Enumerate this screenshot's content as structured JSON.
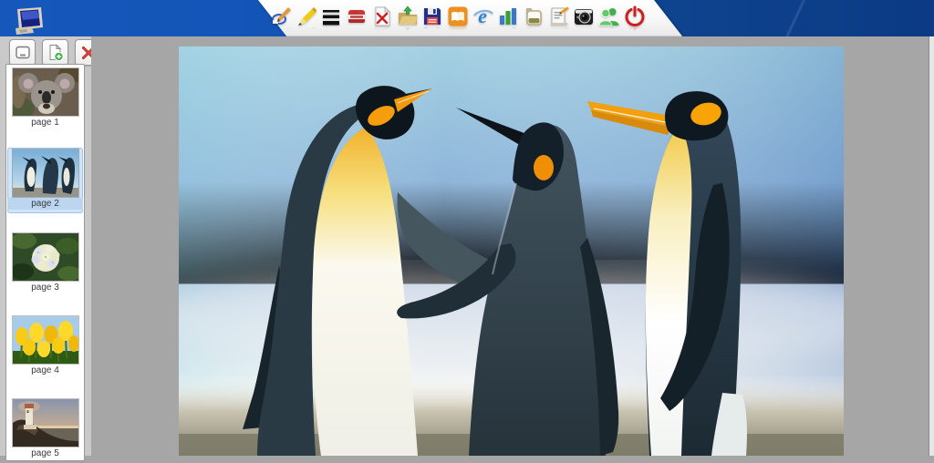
{
  "titlebar": {
    "desktop_icon": "my-computer"
  },
  "toolbar": {
    "items": [
      {
        "name": "pen"
      },
      {
        "name": "highlighter"
      },
      {
        "name": "line-width"
      },
      {
        "name": "eraser"
      },
      {
        "name": "clear-page"
      },
      {
        "name": "open-folder"
      },
      {
        "name": "save"
      },
      {
        "name": "book"
      },
      {
        "name": "browser"
      },
      {
        "name": "chart"
      },
      {
        "name": "cup"
      },
      {
        "name": "notes"
      },
      {
        "name": "camera"
      },
      {
        "name": "users"
      },
      {
        "name": "power"
      }
    ]
  },
  "sidebar": {
    "buttons": [
      {
        "name": "board"
      },
      {
        "name": "add-page"
      },
      {
        "name": "delete-page"
      }
    ],
    "pages": [
      {
        "label": "page 1",
        "subject": "koala",
        "selected": false
      },
      {
        "label": "page 2",
        "subject": "penguins",
        "selected": true
      },
      {
        "label": "page 3",
        "subject": "flower",
        "selected": false
      },
      {
        "label": "page 4",
        "subject": "tulips",
        "selected": false
      },
      {
        "label": "page 5",
        "subject": "lighthouse",
        "selected": false
      }
    ],
    "selected_page": "page 2"
  },
  "canvas": {
    "image_subject": "three king penguins on snow"
  },
  "colors": {
    "titlebar_left": "#1557ba",
    "titlebar_right": "#0c3a84",
    "toolbar_bg": "#ffffff",
    "sidebar_bg": "#c9c9c9",
    "canvas_bg": "#a6a6a6",
    "selected_highlight": "#cfe4f8"
  }
}
